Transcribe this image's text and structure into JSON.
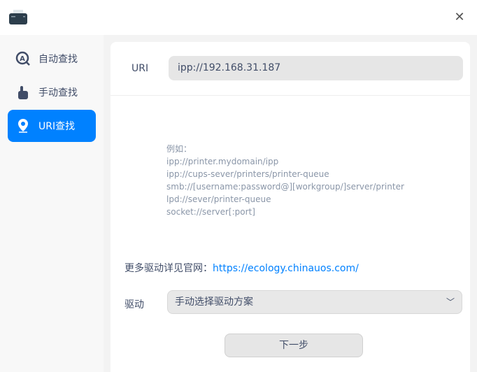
{
  "window": {
    "close_icon": "close-icon"
  },
  "sidebar": {
    "items": [
      {
        "label": "自动查找",
        "icon": "auto-search-icon"
      },
      {
        "label": "手动查找",
        "icon": "hand-pointer-icon"
      },
      {
        "label": "URI查找",
        "icon": "location-pin-icon",
        "active": true
      }
    ]
  },
  "main": {
    "uri_label": "URI",
    "uri_value": "ipp://192.168.31.187",
    "examples": [
      "例如：",
      "ipp://printer.mydomain/ipp",
      "ipp://cups-sever/printers/printer-queue",
      "smb://[username:password@][workgroup/]server/printer",
      "lpd://sever/printer-queue",
      "socket://server[:port]"
    ],
    "more_drivers_label": "更多驱动详见官网：",
    "more_drivers_link": "https://ecology.chinauos.com/",
    "driver_label": "驱动",
    "driver_value": "手动选择驱动方案",
    "next_label": "下一步"
  },
  "colors": {
    "accent": "#0081ff"
  }
}
